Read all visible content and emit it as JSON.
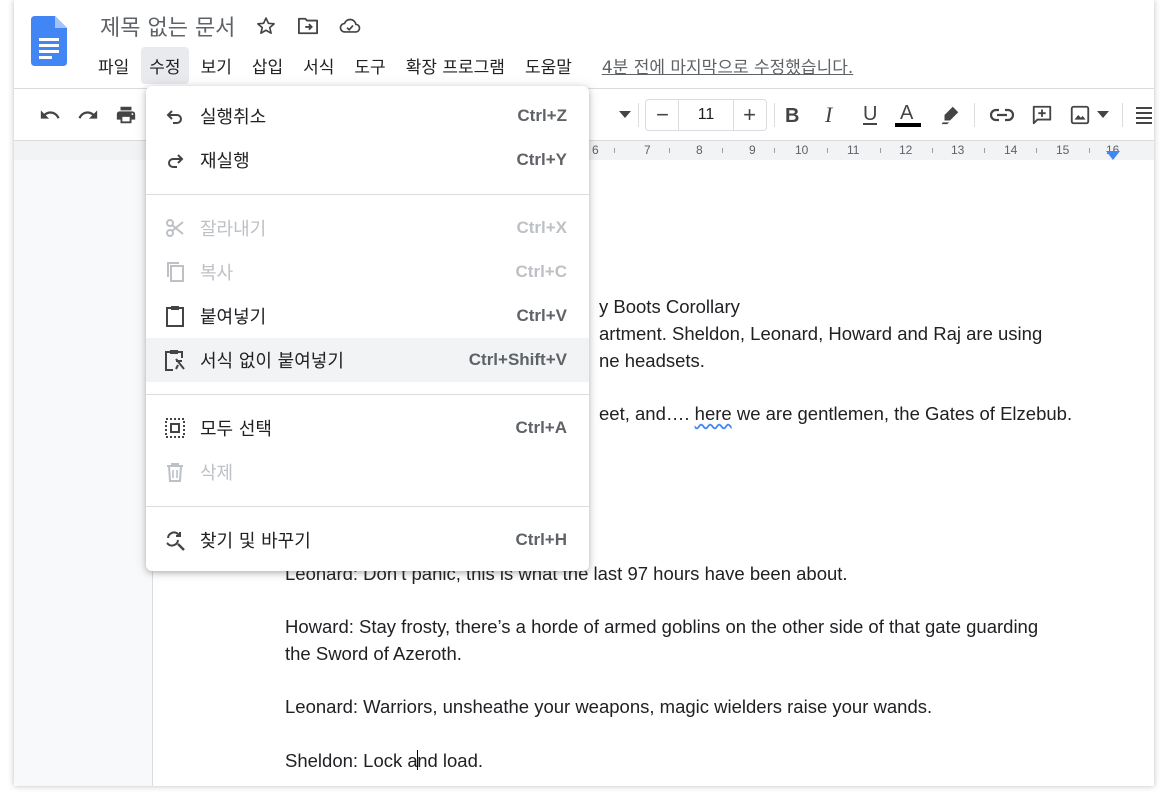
{
  "app": {
    "doc_title": "제목 없는 문서",
    "last_edit": "4분 전에 마지막으로 수정했습니다."
  },
  "menubar": {
    "items": [
      "파일",
      "수정",
      "보기",
      "삽입",
      "서식",
      "도구",
      "확장 프로그램",
      "도움말"
    ],
    "active": "수정"
  },
  "toolbar": {
    "font_size": "11",
    "minus": "−",
    "plus": "+"
  },
  "ruler": {
    "numbers": [
      "6",
      "7",
      "8",
      "9",
      "10",
      "11",
      "12",
      "13",
      "14",
      "15",
      "16"
    ]
  },
  "edit_menu": {
    "items": [
      {
        "label": "실행취소",
        "shortcut": "Ctrl+Z",
        "icon": "undo-icon",
        "enabled": true
      },
      {
        "label": "재실행",
        "shortcut": "Ctrl+Y",
        "icon": "redo-icon",
        "enabled": true
      },
      {
        "label": "잘라내기",
        "shortcut": "Ctrl+X",
        "icon": "cut-icon",
        "enabled": false
      },
      {
        "label": "복사",
        "shortcut": "Ctrl+C",
        "icon": "copy-icon",
        "enabled": false
      },
      {
        "label": "붙여넣기",
        "shortcut": "Ctrl+V",
        "icon": "paste-icon",
        "enabled": true
      },
      {
        "label": "서식 없이 붙여넣기",
        "shortcut": "Ctrl+Shift+V",
        "icon": "paste-plain-icon",
        "enabled": true,
        "hovered": true
      },
      {
        "label": "모두 선택",
        "shortcut": "Ctrl+A",
        "icon": "select-all-icon",
        "enabled": true
      },
      {
        "label": "삭제",
        "shortcut": "",
        "icon": "delete-icon",
        "enabled": false
      },
      {
        "label": "찾기 및 바꾸기",
        "shortcut": "Ctrl+H",
        "icon": "find-replace-icon",
        "enabled": true
      }
    ]
  },
  "document": {
    "lines": {
      "l1": "y Boots Corollary",
      "l2": "artment. Sheldon, Leonard, Howard and Raj are using",
      "l3": "ne headsets.",
      "l4a": "eet, and…. ",
      "l4b": "here",
      "l4c": " we are gentlemen, the Gates of Elzebub.",
      "l5": "Leonard: Don’t panic, this is what the last 97 hours have been about.",
      "l6": "Howard: Stay frosty, there’s a horde of armed goblins on the other side of that gate guarding",
      "l7": "the Sword of Azeroth.",
      "l8": "Leonard: Warriors, unsheathe your weapons, magic wielders raise your wands.",
      "l9a": "Sheldon: Lock a",
      "l9b": "nd load."
    }
  },
  "colors": {
    "docs_blue": "#4285f4",
    "menu_active_bg": "#e8eaed",
    "hover_bg": "#f1f3f4",
    "disabled_text": "#bdc1c6"
  }
}
